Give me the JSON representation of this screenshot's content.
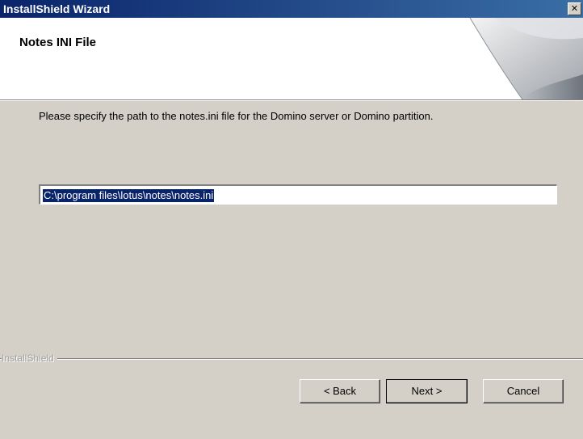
{
  "window": {
    "title": "InstallShield Wizard",
    "close_glyph": "✕"
  },
  "header": {
    "title": "Notes INI File"
  },
  "body": {
    "prompt": "Please specify the path to the notes.ini file for the Domino server or Domino partition.",
    "path_value": "C:\\program files\\lotus\\notes\\notes.ini"
  },
  "footer": {
    "brand": "InstallShield",
    "buttons": {
      "back": "< Back",
      "next": "Next >",
      "cancel": "Cancel"
    }
  },
  "colors": {
    "titlebar": "#0a246a",
    "selection": "#0a246a",
    "face": "#d4d0c8"
  },
  "icons": [
    "close-icon",
    "header-graphic"
  ]
}
